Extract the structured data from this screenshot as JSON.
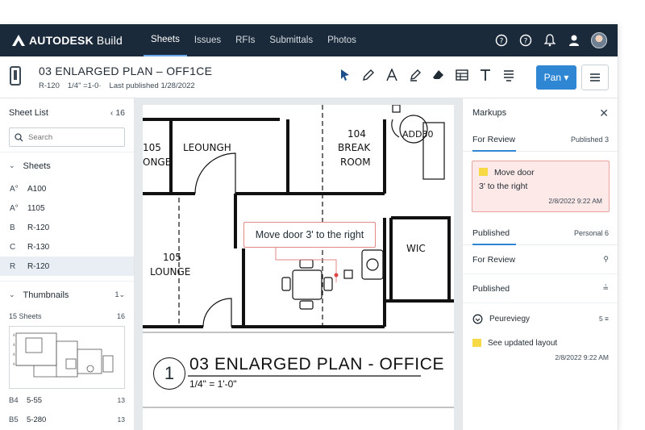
{
  "app": {
    "brand": "AUTODESK",
    "product": "Build",
    "nav": [
      "Sheets",
      "Issues",
      "RFIs",
      "Submittals",
      "Photos"
    ],
    "active_nav": "Sheets"
  },
  "sheet": {
    "title": "03 ENLARGED PLAN – OFF1CE",
    "number": "R-120",
    "scale": "1/4\" =1-0·",
    "published": "Last published 1/28/2022"
  },
  "toolbar": {
    "pan_label": "Pan ▾"
  },
  "left": {
    "title": "Sheet List",
    "count": "‹  16",
    "search_placeholder": "Search",
    "sheets_header": "Sheets",
    "sheets": [
      {
        "prefix": "A°",
        "name": "A100"
      },
      {
        "prefix": "A°",
        "name": "1105"
      },
      {
        "prefix": "B",
        "name": "R-120"
      },
      {
        "prefix": "C",
        "name": "R-130"
      },
      {
        "prefix": "R",
        "name": "R-120"
      }
    ],
    "thumbnails_header": "Thumbnails",
    "thumbnails_count": "1",
    "thumb_sub": "15 Sheets",
    "thumb_sub_count": "16",
    "thumb_rows": [
      {
        "prefix": "B4",
        "name": "5-55",
        "num": "13"
      },
      {
        "prefix": "B5",
        "name": "5-280",
        "num": "13"
      }
    ]
  },
  "drawing": {
    "rooms": {
      "r1_num": "105",
      "r1_name": "ONGE",
      "r1_extra": "LEOUNGH",
      "r2_num": "104",
      "r2_name1": "BREAK",
      "r2_name2": "ROOM",
      "r3": "ADD30",
      "r4_num": "105",
      "r4_name": "LOUNGE",
      "r5": "WIC"
    },
    "callout": "Move door 3' to the right",
    "plan_number": "1",
    "plan_title": "03 ENLARGED PLAN - OFFICE",
    "plan_scale": "1/4\" = 1'-0\""
  },
  "right": {
    "title": "Markups",
    "tab_for_review": "For Review",
    "tab_for_review_meta": "Published  3",
    "card": {
      "line1": "Move door",
      "line2": "3' to the right",
      "timestamp": "2/8/2022 9:22 AM"
    },
    "published_tab": "Published",
    "published_meta": "Personal  6",
    "row_for_review": "For Review",
    "row_published": "Published",
    "activity": [
      {
        "text": "Peureviegy",
        "meta": "5 ≡"
      },
      {
        "text": "See updated layout",
        "meta": ""
      }
    ],
    "activity_ts": "2/8/2022 9:22 AM"
  }
}
